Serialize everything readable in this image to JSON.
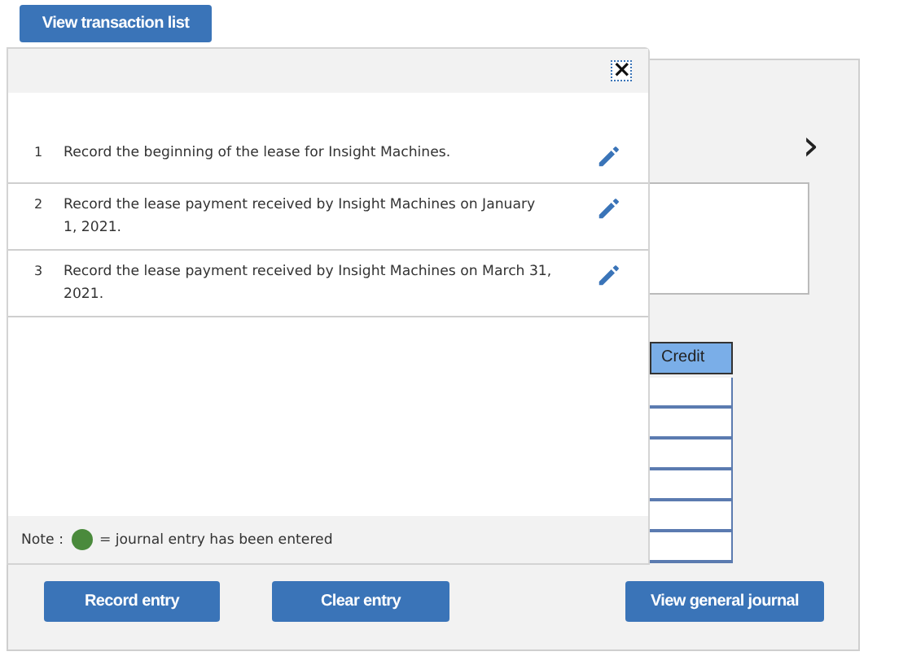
{
  "top_button": "View transaction list",
  "popup": {
    "close": "×",
    "transactions": [
      {
        "number": "1",
        "text": "Record the beginning of the lease for Insight Machines."
      },
      {
        "number": "2",
        "text": "Record the lease payment received by Insight Machines on January 1, 2021."
      },
      {
        "number": "3",
        "text": "Record the lease payment received by Insight Machines on March 31, 2021."
      }
    ],
    "note": {
      "label": "Note :",
      "color": "#4a8a3c",
      "text": "= journal entry has been entered"
    }
  },
  "journal": {
    "next": "›",
    "credit_header": "Credit"
  },
  "buttons": [
    "Record entry",
    "Clear entry",
    "View general journal"
  ]
}
